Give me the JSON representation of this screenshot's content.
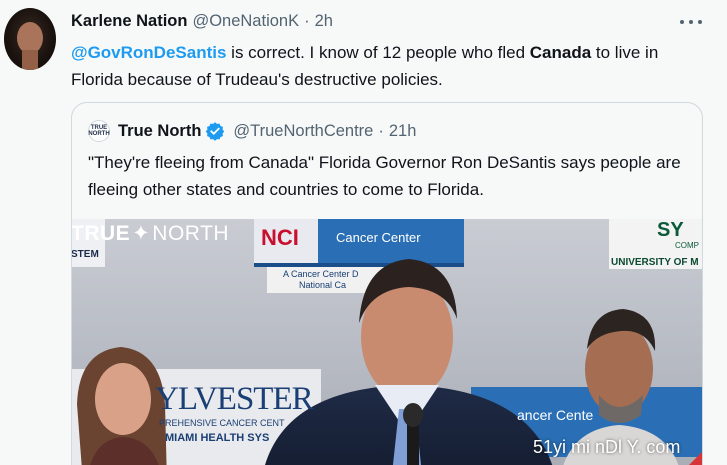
{
  "tweet": {
    "author_name": "Karlene Nation",
    "author_handle": "@OneNationK",
    "time": "2h",
    "text_mention": "@GovRonDeSantis",
    "text_part1": " is correct.  I know of 12 people who fled ",
    "text_bold": "Canada",
    "text_part2": " to live in Florida because of Trudeau's destructive policies."
  },
  "quote": {
    "avatar_text_top": "TRUE",
    "avatar_text_bottom": "NORTH",
    "author_name": "True North",
    "author_handle": "@TrueNorthCentre",
    "time": "21h",
    "text": "\"They're fleeing from Canada\" Florida Governor Ron DeSantis says people are fleeing other states and countries to come to Florida."
  },
  "media": {
    "watermark_left": "TRUE",
    "watermark_right": "NORTH",
    "sign_nci": "NCI",
    "sign_cancer_center": "Cancer Center",
    "sign_nci_sub1": "A Cancer Center D",
    "sign_nci_sub2": "National Ca",
    "sign_stem": "STEM",
    "sign_univ_letters": "SY",
    "sign_univ_comp": "COMP",
    "sign_univ": "UNIVERSITY OF M",
    "sign_sylvester": "YLVESTER",
    "sign_sylvester_sub": "PREHENSIVE CANCER CENT",
    "sign_miami_health": "MIAMI HEALTH SYS",
    "sign_cancer_cente2": "ancer Cente",
    "site_watermark": "51yi mi nDl Y. com"
  },
  "colors": {
    "accent": "#1d9bf0",
    "verified": "#1d9bf0",
    "text_primary": "#0f1419",
    "text_secondary": "#536471"
  },
  "icons": [
    "more-icon",
    "verified-badge-icon"
  ]
}
